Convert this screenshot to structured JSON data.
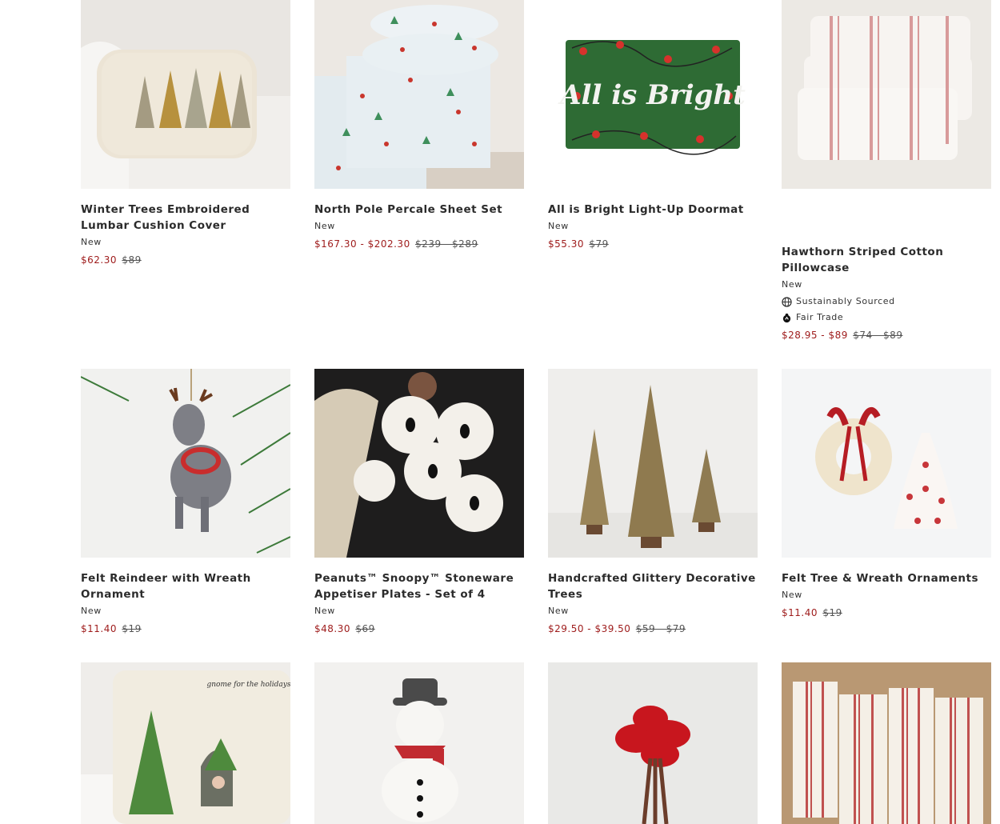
{
  "products": [
    {
      "title": "Winter Trees Embroidered Lumbar Cushion Cover",
      "badge": "New",
      "sale": "$62.30",
      "orig": "$89"
    },
    {
      "title": "North Pole Percale Sheet Set",
      "badge": "New",
      "sale": "$167.30 - $202.30",
      "orig": "$239 - $289"
    },
    {
      "title": "All is Bright Light-Up Doormat",
      "badge": "New",
      "sale": "$55.30",
      "orig": "$79",
      "mat_text": "All is Bright"
    },
    {
      "title": "Hawthorn Striped Cotton Pillowcase",
      "badge": "New",
      "tag1": "Sustainably Sourced",
      "tag2": "Fair Trade",
      "sale": "$28.95 - $89",
      "orig": "$74 - $89"
    },
    {
      "title": "Felt Reindeer with Wreath Ornament",
      "badge": "New",
      "sale": "$11.40",
      "orig": "$19"
    },
    {
      "title": "Peanuts™ Snoopy™ Stoneware Appetiser Plates - Set of 4",
      "badge": "New",
      "sale": "$48.30",
      "orig": "$69"
    },
    {
      "title": "Handcrafted Glittery Decorative Trees",
      "badge": "New",
      "sale": "$29.50 - $39.50",
      "orig": "$59 - $79"
    },
    {
      "title": "Felt Tree & Wreath Ornaments",
      "badge": "New",
      "sale": "$11.40",
      "orig": "$19"
    },
    {
      "pillow_text": "gnome for the holidays"
    }
  ],
  "colors": {
    "sale": "#9e1b1b",
    "title": "#2b2b2b",
    "text": "#333333"
  }
}
